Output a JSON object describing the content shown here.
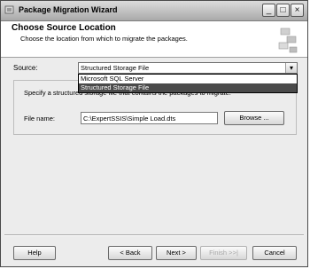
{
  "window": {
    "title": "Package Migration Wizard"
  },
  "header": {
    "title": "Choose Source Location",
    "subtitle": "Choose the location from which to migrate the packages."
  },
  "source": {
    "label": "Source:",
    "selected": "Structured Storage File",
    "options": [
      "Microsoft SQL Server",
      "Structured Storage File"
    ],
    "highlighted_option": "Structured Storage File"
  },
  "file_group": {
    "description": "Specify a structured storage file that contains the packages to migrate.",
    "file_name_label": "File name:",
    "file_name_value": "C:\\ExpertSSIS\\Simple Load.dts",
    "browse_label": "Browse ..."
  },
  "footer": {
    "help": "Help",
    "back": "< Back",
    "next": "Next >",
    "finish": "Finish >>|",
    "cancel": "Cancel"
  }
}
